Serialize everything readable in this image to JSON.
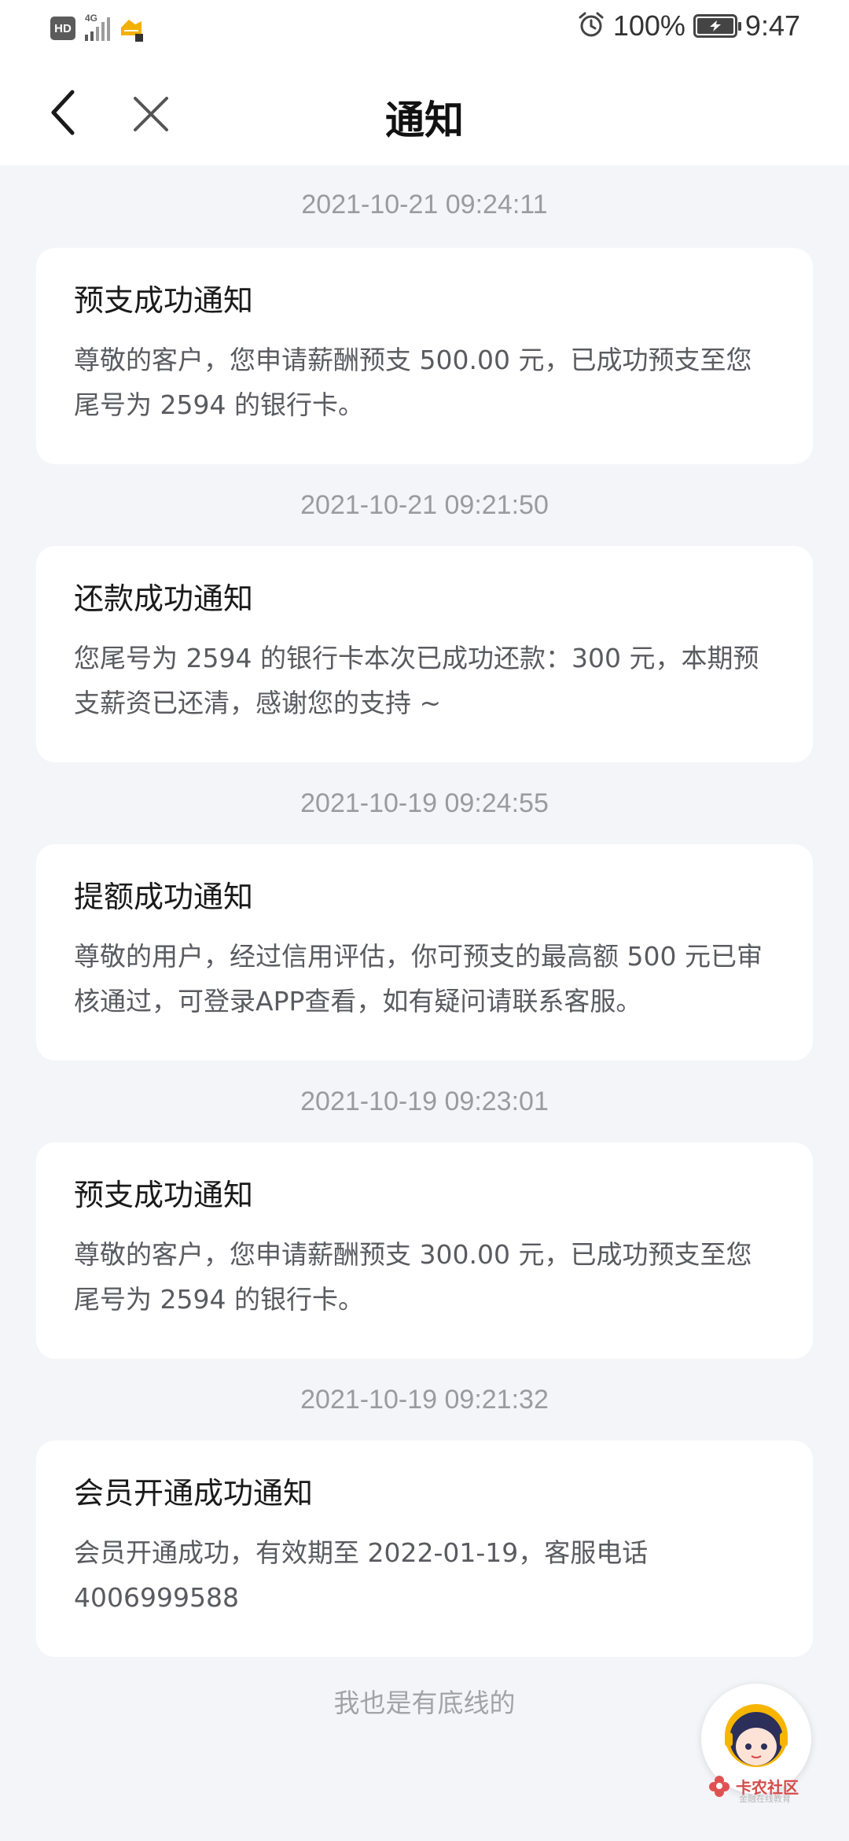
{
  "status_bar": {
    "hd_badge": "HD",
    "network": "4G",
    "battery_percent": "100%",
    "time": "9:47"
  },
  "header": {
    "title": "通知"
  },
  "notifications": [
    {
      "timestamp": "2021-10-21 09:24:11",
      "title": "预支成功通知",
      "body": "尊敬的客户，您申请薪酬预支 500.00 元，已成功预支至您尾号为 2594 的银行卡。"
    },
    {
      "timestamp": "2021-10-21 09:21:50",
      "title": "还款成功通知",
      "body": "您尾号为 2594 的银行卡本次已成功还款：300 元，本期预支薪资已还清，感谢您的支持 ~"
    },
    {
      "timestamp": "2021-10-19 09:24:55",
      "title": "提额成功通知",
      "body": "尊敬的用户，经过信用评估，你可预支的最高额 500 元已审核通过，可登录APP查看，如有疑问请联系客服。"
    },
    {
      "timestamp": "2021-10-19 09:23:01",
      "title": "预支成功通知",
      "body": "尊敬的客户，您申请薪酬预支 300.00 元，已成功预支至您尾号为 2594 的银行卡。"
    },
    {
      "timestamp": "2021-10-19 09:21:32",
      "title": "会员开通成功通知",
      "body": "会员开通成功，有效期至 2022-01-19，客服电话 4006999588"
    }
  ],
  "footer_note": "我也是有底线的",
  "community_badge": {
    "label": "卡农社区",
    "sub": "金融在线教育"
  },
  "icons": {
    "back": "chevron-left-icon",
    "close": "close-icon",
    "alarm": "alarm-clock-icon",
    "battery": "battery-charging-icon"
  }
}
